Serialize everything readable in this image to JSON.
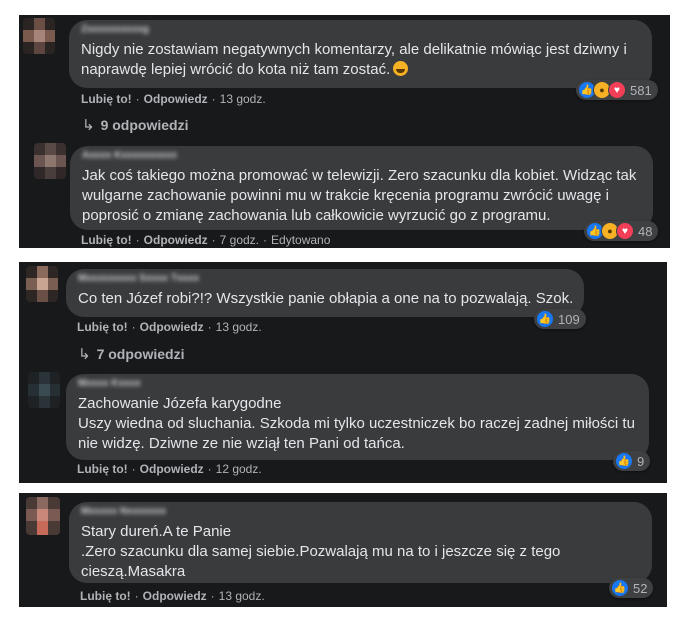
{
  "labels": {
    "like": "Lubię to!",
    "reply": "Odpowiedz"
  },
  "comments": [
    {
      "name": "Zxxxxxxxxxxg",
      "lines": [
        "Nigdy nie zostawiam negatywnych komentarzy, ale delikatnie mówiąc jest dziwny i",
        "naprawdę lepiej wrócić do kota niż tam zostać."
      ],
      "time": "13 godz.",
      "reactions_count": "581",
      "replies_label": "9 odpowiedzi"
    },
    {
      "name": "Axxxx Kxxxxxxxxxx",
      "lines": [
        "Jak coś takiego można promować w telewizji. Zero szacunku dla kobiet. Widząc tak",
        "wulgarne zachowanie powinni mu w trakcie kręcenia programu zwrócić uwagę i",
        "poprosić o zmianę zachowania lub całkowicie wyrzucić go z programu."
      ],
      "time": "7 godz.",
      "edited": "Edytowano",
      "reactions_count": "48"
    },
    {
      "name": "Mxxxxxxxxx Sxxxx Txxxx",
      "lines": [
        "Co ten Józef robi?!? Wszystkie panie obłapia a one na to pozwalają. Szok."
      ],
      "time": "13 godz.",
      "reactions_count": "109",
      "replies_label": "7 odpowiedzi"
    },
    {
      "name": "Mxxxx Kxxxx",
      "lines": [
        "Zachowanie Józefa karygodne",
        "Uszy wiedna od sluchania. Szkoda mi tylko uczestniczek bo raczej zadnej miłości tu",
        "nie widzę. Dziwne ze nie wziął ten Pani od tańca."
      ],
      "time": "12 godz.",
      "reactions_count": "9"
    },
    {
      "name": "Mxxxxx Nxxxxxxx",
      "lines": [
        "Stary dureń.A te Panie",
        ".Zero szacunku dla samej siebie.Pozwalają mu na to i jeszcze się z tego",
        "cieszą.Masakra"
      ],
      "time": "13 godz.",
      "reactions_count": "52"
    }
  ],
  "colors": {
    "panel": "#18191a",
    "bubble": "#3a3b3c",
    "text": "#e4e6eb",
    "meta": "#b0b3b8",
    "like": "#1877f2",
    "love": "#f33e58",
    "haha": "#f7b125"
  }
}
